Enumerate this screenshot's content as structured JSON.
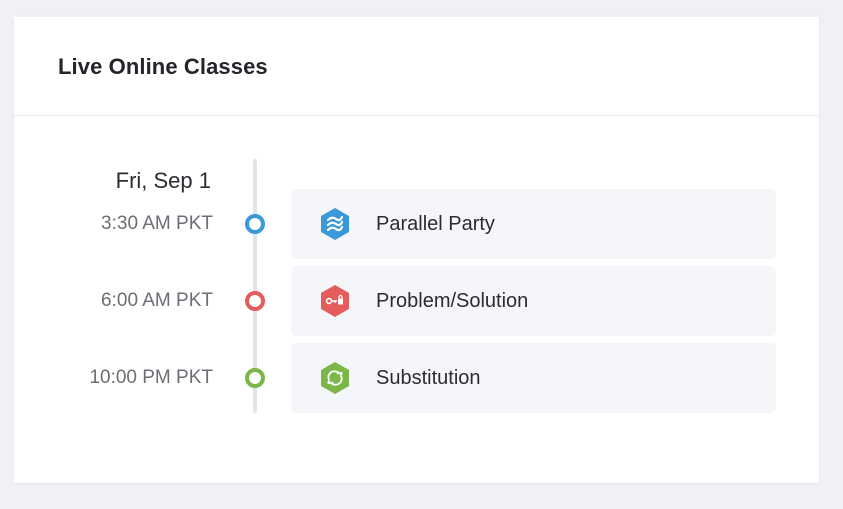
{
  "card": {
    "title": "Live Online Classes"
  },
  "timeline": {
    "date": "Fri, Sep 1",
    "items": [
      {
        "time": "3:30 AM PKT",
        "class_name": "Parallel Party",
        "icon": "parallel-lines-icon",
        "color": "#3a9ad9"
      },
      {
        "time": "6:00 AM PKT",
        "class_name": "Problem/Solution",
        "icon": "key-lock-icon",
        "color": "#e45c5c"
      },
      {
        "time": "10:00 PM PKT",
        "class_name": "Substitution",
        "icon": "swap-arrows-icon",
        "color": "#7ab648"
      }
    ]
  }
}
